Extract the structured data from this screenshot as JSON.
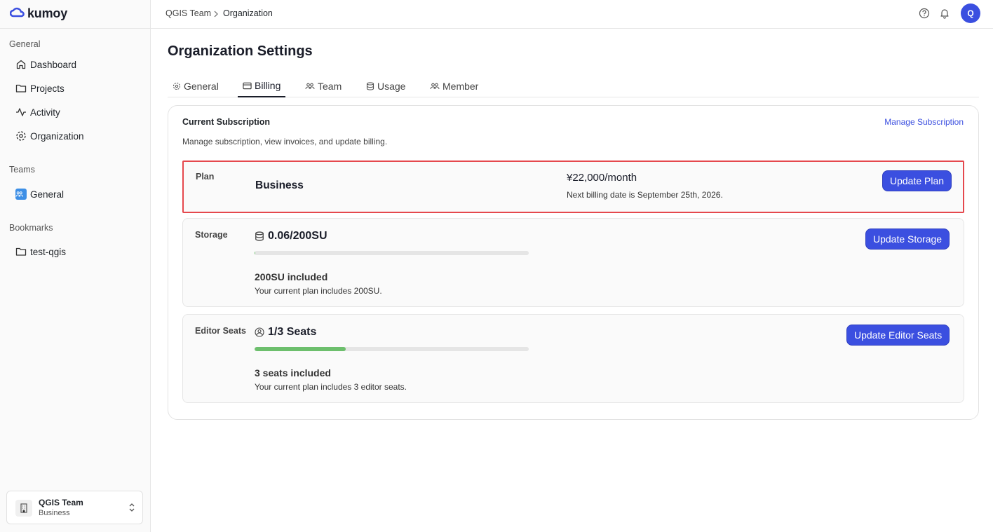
{
  "brand": {
    "name": "kumoy"
  },
  "sidebar": {
    "general_label": "General",
    "nav": [
      {
        "label": "Dashboard",
        "icon": "home-icon"
      },
      {
        "label": "Projects",
        "icon": "folder-icon"
      },
      {
        "label": "Activity",
        "icon": "activity-icon"
      },
      {
        "label": "Organization",
        "icon": "gear-icon"
      }
    ],
    "teams_label": "Teams",
    "teams": [
      {
        "label": "General",
        "icon": "team-icon"
      }
    ],
    "bookmarks_label": "Bookmarks",
    "bookmarks": [
      {
        "label": "test-qgis",
        "icon": "folder-icon"
      }
    ],
    "team_switcher": {
      "name": "QGIS Team",
      "plan": "Business"
    }
  },
  "topbar": {
    "breadcrumb": [
      "QGIS Team",
      "Organization"
    ],
    "avatar_initial": "Q"
  },
  "page": {
    "title": "Organization Settings",
    "tabs": [
      {
        "label": "General",
        "icon": "gear-icon",
        "active": false
      },
      {
        "label": "Billing",
        "icon": "card-icon",
        "active": true
      },
      {
        "label": "Team",
        "icon": "users-icon",
        "active": false
      },
      {
        "label": "Usage",
        "icon": "database-icon",
        "active": false
      },
      {
        "label": "Member",
        "icon": "users-icon",
        "active": false
      }
    ]
  },
  "subscription": {
    "title": "Current Subscription",
    "manage_link": "Manage Subscription",
    "description": "Manage subscription, view invoices, and update billing.",
    "plan": {
      "label": "Plan",
      "name": "Business",
      "price": "¥22,000/month",
      "next_billing": "Next billing date is September 25th, 2026.",
      "button": "Update Plan"
    },
    "storage": {
      "label": "Storage",
      "value": "0.06/200SU",
      "progress": 0.0003,
      "included": "200SU included",
      "included_sub": "Your current plan includes 200SU.",
      "button": "Update Storage"
    },
    "seats": {
      "label": "Editor Seats",
      "value": "1/3 Seats",
      "progress": 0.3333,
      "included": "3 seats included",
      "included_sub": "Your current plan includes 3 editor seats.",
      "button": "Update Editor Seats"
    }
  },
  "colors": {
    "accent": "#3b4fe0",
    "highlight": "#e5484d",
    "progress": "#6dbf6d"
  }
}
